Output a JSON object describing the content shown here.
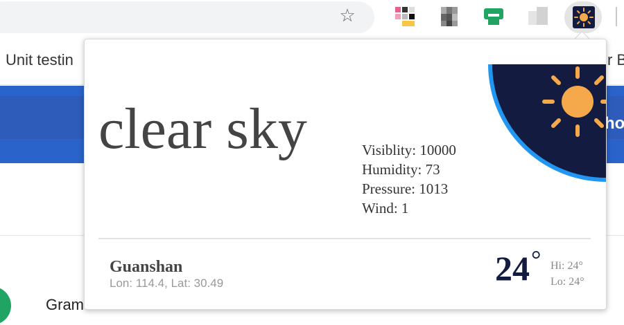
{
  "browser": {
    "bookmarks": {
      "left_item": "Unit testin",
      "right_item": "r B"
    },
    "page": {
      "right_text": "hoo",
      "list_item": "Gram"
    }
  },
  "popup": {
    "condition": "clear sky",
    "details": [
      {
        "label": "Visiblity:",
        "value": "10000"
      },
      {
        "label": "Humidity:",
        "value": "73"
      },
      {
        "label": "Pressure:",
        "value": "1013"
      },
      {
        "label": "Wind:",
        "value": "1"
      }
    ],
    "location": {
      "city": "Guanshan",
      "lon_label": "Lon:",
      "lon": "114.4",
      "lat_label": "Lat:",
      "lat": "30.49"
    },
    "temperature": {
      "current": "24",
      "degree_symbol": "°",
      "high_label": "Hi:",
      "high": "24°",
      "low_label": "Lo:",
      "low": "24°"
    },
    "icon": "sun-icon"
  },
  "colors": {
    "sun_bg": "#131c40",
    "sun_ring": "#2196f3",
    "sun": "#f5a94a",
    "temp": "#131c40",
    "page_blue": "#2a63c9"
  }
}
